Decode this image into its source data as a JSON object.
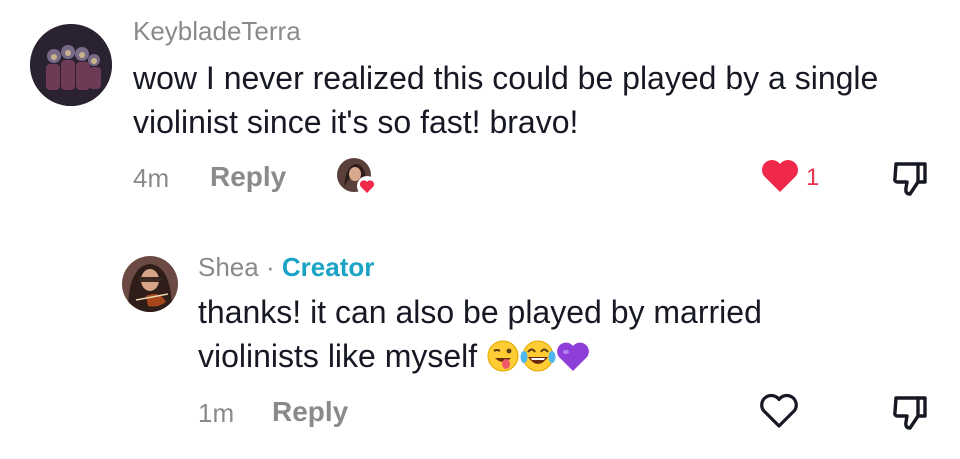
{
  "comments": [
    {
      "username": "KeybladeTerra",
      "text": "wow I never realized this could be played by a single violinist since it's so fast! bravo!",
      "time": "4m",
      "reply_label": "Reply",
      "like_count": "1",
      "liked": true,
      "creator_liked": true
    }
  ],
  "replies": [
    {
      "username": "Shea",
      "separator": "·",
      "badge": "Creator",
      "text": "thanks! it can also be played by married violinists like myself",
      "emojis": [
        "winking-face-with-tongue",
        "face-with-tears-of-joy",
        "purple-heart"
      ],
      "time": "1m",
      "reply_label": "Reply",
      "liked": false
    }
  ],
  "colors": {
    "like_active": "#f0284a",
    "creator_badge": "#1aa3c4",
    "muted_text": "#8a8a8a",
    "body_text": "#161823"
  }
}
